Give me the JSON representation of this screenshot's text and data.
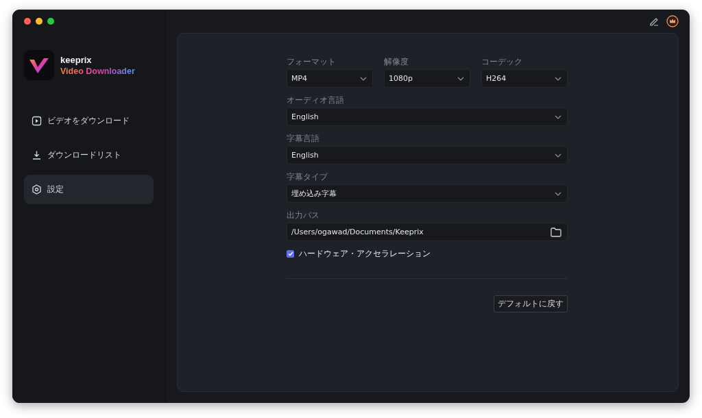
{
  "app": {
    "name": "keeprix",
    "subtitle": "Video Downloader"
  },
  "sidebar": {
    "items": [
      {
        "label": "ビデオをダウンロード",
        "kind": "play",
        "selected": false
      },
      {
        "label": "ダウンロードリスト",
        "kind": "download",
        "selected": false
      },
      {
        "label": "設定",
        "kind": "settings",
        "selected": true
      }
    ]
  },
  "settings": {
    "rows": [
      {
        "fields": [
          {
            "label": "フォーマット",
            "value": "MP4",
            "kind": "select"
          },
          {
            "label": "解像度",
            "value": "1080p",
            "kind": "select"
          },
          {
            "label": "コーデック",
            "value": "H264",
            "kind": "select"
          }
        ]
      },
      {
        "fields": [
          {
            "label": "オーディオ言語",
            "value": "English",
            "kind": "select"
          }
        ]
      },
      {
        "fields": [
          {
            "label": "字幕言語",
            "value": "English",
            "kind": "select"
          }
        ]
      },
      {
        "fields": [
          {
            "label": "字幕タイプ",
            "value": "埋め込み字幕",
            "kind": "select"
          }
        ]
      },
      {
        "fields": [
          {
            "label": "出力パス",
            "value": "/Users/ogawad/Documents/Keeprix",
            "kind": "path"
          }
        ]
      }
    ],
    "checkbox": {
      "label": "ハードウェア・アクセラレーション",
      "checked": true
    },
    "reset_button": "デフォルトに戻す"
  }
}
